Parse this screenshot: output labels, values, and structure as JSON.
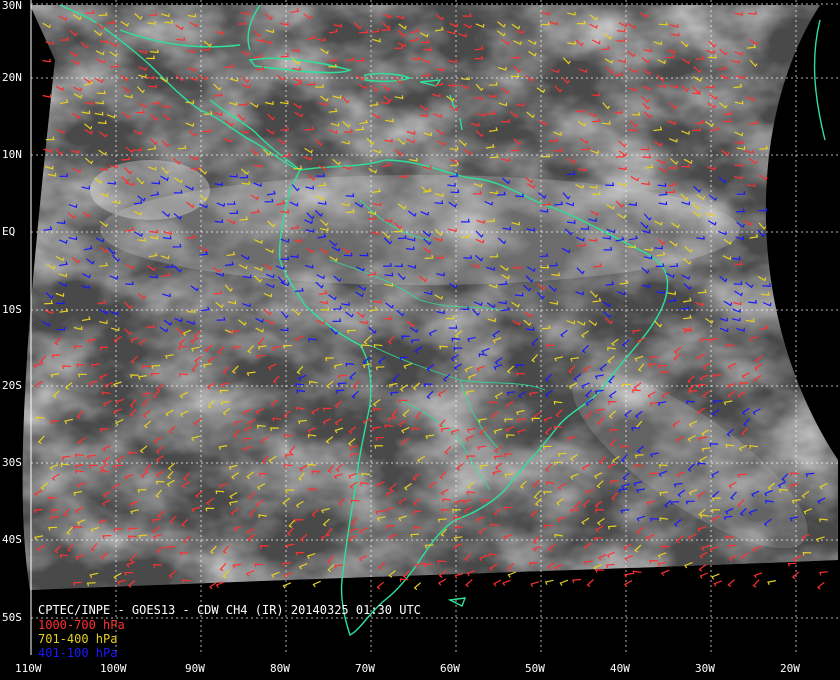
{
  "title_line": "CPTEC/INPE - GOES13 - CDW CH4 (IR) 20140325 01:30 UTC",
  "legend": [
    {
      "label": "1000-700 hPa",
      "color": "#ff3030"
    },
    {
      "label": "701-400 hPa",
      "color": "#e6d020"
    },
    {
      "label": "401-100 hPa",
      "color": "#1a1aff"
    }
  ],
  "lat_labels": [
    "30N",
    "20N",
    "10N",
    "EQ",
    "10S",
    "20S",
    "30S",
    "40S",
    "50S"
  ],
  "lon_labels": [
    "110W",
    "100W",
    "90W",
    "80W",
    "70W",
    "60W",
    "50W",
    "40W",
    "30W",
    "20W"
  ],
  "colors": {
    "coast": "#2ee09a",
    "grid": "#ffffff",
    "background": "#000000"
  }
}
